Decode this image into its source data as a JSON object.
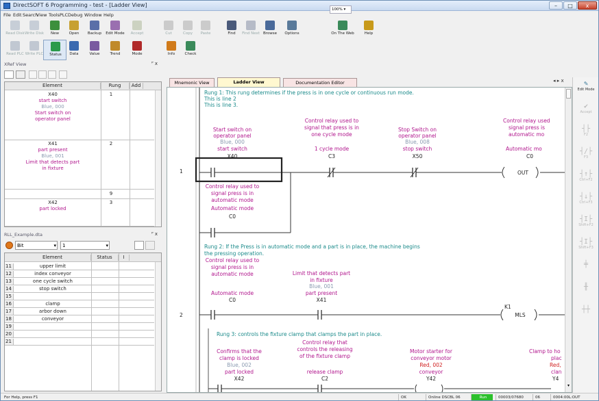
{
  "window": {
    "title": "DirectSOFT 6 Programming - test - [Ladder View]",
    "btn_min": "–",
    "btn_max": "□",
    "btn_close": "x"
  },
  "menu": [
    "File",
    "Edit",
    "Search",
    "View",
    "Tools",
    "PLC",
    "Debug",
    "Window",
    "Help"
  ],
  "toolbar1": [
    {
      "label": "Read Disk",
      "disabled": true,
      "color": "#7a8fa8",
      "icon": "disk-read-icon"
    },
    {
      "label": "Write Disk",
      "disabled": true,
      "color": "#7a8fa8",
      "icon": "disk-write-icon"
    },
    {
      "label": "New",
      "disabled": false,
      "color": "#3c8f3c",
      "icon": "new-program-icon"
    },
    {
      "label": "Open",
      "disabled": false,
      "color": "#c7a032",
      "icon": "open-folder-icon"
    },
    {
      "label": "Backup",
      "disabled": false,
      "color": "#5a6fa8",
      "icon": "backup-icon"
    },
    {
      "label": "Edit Mode",
      "disabled": false,
      "color": "#9a6fb0",
      "icon": "edit-mode-icon"
    },
    {
      "label": "Accept",
      "disabled": true,
      "color": "#8a9a6a",
      "icon": "accept-icon"
    },
    {
      "label": "Cut",
      "disabled": true,
      "color": "#888888",
      "icon": "cut-icon"
    },
    {
      "label": "Copy",
      "disabled": true,
      "color": "#888888",
      "icon": "copy-icon"
    },
    {
      "label": "Paste",
      "disabled": true,
      "color": "#888888",
      "icon": "paste-icon"
    },
    {
      "label": "Find",
      "disabled": false,
      "color": "#4a5a7a",
      "icon": "find-icon"
    },
    {
      "label": "Find Next",
      "disabled": true,
      "color": "#4a5a7a",
      "icon": "find-next-icon"
    },
    {
      "label": "Browse",
      "disabled": false,
      "color": "#4a6a9a",
      "icon": "browse-icon"
    },
    {
      "label": "Options",
      "disabled": false,
      "color": "#5a7a9a",
      "icon": "options-icon"
    },
    {
      "label": "On The Web",
      "disabled": false,
      "color": "#3a8a5a",
      "icon": "web-icon"
    },
    {
      "label": "Help",
      "disabled": false,
      "color": "#c89a1a",
      "icon": "help-icon"
    }
  ],
  "zoom": "100%",
  "toolbar2": [
    {
      "label": "Read PLC",
      "disabled": true,
      "color": "#6a7f9a",
      "icon": "read-plc-icon"
    },
    {
      "label": "Write PLC",
      "disabled": true,
      "color": "#6a7f9a",
      "icon": "write-plc-icon"
    },
    {
      "label": "Status",
      "disabled": false,
      "color": "#2a9a4a",
      "icon": "status-icon"
    },
    {
      "label": "Data",
      "disabled": false,
      "color": "#3a6ab0",
      "icon": "data-icon"
    },
    {
      "label": "Value",
      "disabled": false,
      "color": "#7a5aa0",
      "icon": "value-icon"
    },
    {
      "label": "Trend",
      "disabled": false,
      "color": "#c08a2a",
      "icon": "trend-icon"
    },
    {
      "label": "Mode",
      "disabled": false,
      "color": "#b02a2a",
      "icon": "mode-icon"
    },
    {
      "label": "Info",
      "disabled": false,
      "color": "#d07a1a",
      "icon": "info-icon"
    },
    {
      "label": "Check",
      "disabled": false,
      "color": "#3a8a5a",
      "icon": "check-icon"
    }
  ],
  "xref": {
    "title": "XRef View",
    "pin": "ᴾ x",
    "headers": [
      "Element",
      "Rung",
      "Add"
    ],
    "rows": [
      {
        "lines": [
          [
            "X40",
            "blk"
          ],
          [
            "start switch",
            "mag"
          ],
          [
            "Blue, 000",
            "blue"
          ],
          [
            "Start switch on",
            "mag"
          ],
          [
            "operator panel",
            "mag"
          ]
        ],
        "rung": "1"
      },
      {
        "lines": [
          [
            "X41",
            "blk"
          ],
          [
            "part present",
            "mag"
          ],
          [
            "Blue, 001",
            "blue"
          ],
          [
            "Limit that detects part",
            "mag"
          ],
          [
            "in fixture",
            "mag"
          ]
        ],
        "rung": "2"
      },
      {
        "lines": [],
        "rung": "9"
      },
      {
        "lines": [
          [
            "X42",
            "blk"
          ],
          [
            "part locked",
            "mag"
          ]
        ],
        "rung": "3"
      }
    ]
  },
  "rll": {
    "title": "RLL_Example.dta",
    "pin": "ᴾ x",
    "type": "Bit",
    "num": "1",
    "headers": [
      "Element",
      "Status",
      "I"
    ],
    "rows": [
      {
        "n": "11",
        "e": "upper limit"
      },
      {
        "n": "12",
        "e": "index conveyor"
      },
      {
        "n": "13",
        "e": "one cycle switch"
      },
      {
        "n": "14",
        "e": "stop switch"
      },
      {
        "n": "15",
        "e": ""
      },
      {
        "n": "16",
        "e": "clamp"
      },
      {
        "n": "17",
        "e": "arbor down"
      },
      {
        "n": "18",
        "e": "conveyor"
      },
      {
        "n": "19",
        "e": ""
      },
      {
        "n": "20",
        "e": ""
      },
      {
        "n": "21",
        "e": ""
      }
    ]
  },
  "tabs": [
    {
      "label": "Mnemonic View",
      "active": false
    },
    {
      "label": "Ladder View",
      "active": true
    },
    {
      "label": "Documentation Editor",
      "active": false
    }
  ],
  "tab_nav": "◂ ▸ x",
  "rpanel": [
    {
      "g": "✎",
      "l": "Edit Mode"
    },
    {
      "g": "✔",
      "l": "Accept"
    },
    {
      "g": "┤├",
      "l": "F2"
    },
    {
      "g": "┤/├",
      "l": "F3"
    },
    {
      "g": "┤↑├",
      "l": "Ctrl+F2"
    },
    {
      "g": "┤↓├",
      "l": "Ctrl+F3"
    },
    {
      "g": "┤I├",
      "l": "Shift+F2"
    },
    {
      "g": "┤I├",
      "l": "Shift+F3"
    },
    {
      "g": "╪",
      "l": ""
    },
    {
      "g": "╫",
      "l": ""
    },
    {
      "g": "┼┼",
      "l": ""
    }
  ],
  "ladder": {
    "rung1_comment": [
      "Rung 1: This rung determines if the press is in one cycle or continuous run mode.",
      "This is line 2",
      "This is line 3."
    ],
    "rung1_num": "1",
    "c1": {
      "d1": "Start switch on",
      "d2": "operator panel",
      "blue": "Blue, 000",
      "nick": "start switch",
      "addr": "X40"
    },
    "c2": {
      "d1": "Control relay used to",
      "d2": "signal that press is in",
      "d3": "one cycle mode",
      "nick": "1 cycle mode",
      "addr": "C3"
    },
    "c3": {
      "d1": "Stop Switch on",
      "d2": "operator panel",
      "blue": "Blue, 008",
      "nick": "stop switch",
      "addr": "X50"
    },
    "c4": {
      "d1": "Control relay used",
      "d2": "signal press is",
      "d3": "automatic mo",
      "nick": "Automatic mo",
      "addr": "C0",
      "out": "OUT"
    },
    "c5": {
      "d1": "Control relay used to",
      "d2": "signal press is in",
      "d3": "automatic mode",
      "nick": "Automatic mode",
      "addr": "C0"
    },
    "rung2_comment": [
      "Rung 2: If the Press is in automatic mode and a part is in place, the machine begins",
      "the pressing operation."
    ],
    "rung2_num": "2",
    "r2c1": {
      "d1": "Control relay used to",
      "d2": "signal press is in",
      "d3": "automatic mode",
      "nick": "Automatic mode",
      "addr": "C0"
    },
    "r2c2": {
      "d1": "Limit that detects part",
      "d2": "in fixture",
      "blue": "Blue, 001",
      "nick": "part present",
      "addr": "X41"
    },
    "r2coil": {
      "addr": "K1",
      "out": "MLS"
    },
    "rung3_comment": [
      "Rung 3: controls the fixture clamp that clamps the part in place."
    ],
    "r3c1": {
      "d1": "Confirms that the",
      "d2": "clamp is locked",
      "blue": "Blue, 002",
      "nick": "part locked",
      "addr": "X42"
    },
    "r3c2": {
      "d0": "Control relay that",
      "d1": "controls the releasing",
      "d2": "of the fixture clamp",
      "nick": "release clamp",
      "addr": "C2"
    },
    "r3c3": {
      "d1": "Motor starter for",
      "d2": "conveyor motor",
      "red": "Red, 002",
      "nick": "conveyor",
      "addr": "Y42"
    },
    "r3c4": {
      "d1": "Clamp to ho",
      "d2": "plac",
      "red": "Red,",
      "nick": "clan",
      "addr": "Y4"
    }
  },
  "status": {
    "help": "For Help, press F1",
    "ok": "OK",
    "conn": "Online DSCBL 06",
    "run": "Run",
    "scan": "00003/07680",
    "plc": "06",
    "addr": "0004:00L:OUT"
  }
}
